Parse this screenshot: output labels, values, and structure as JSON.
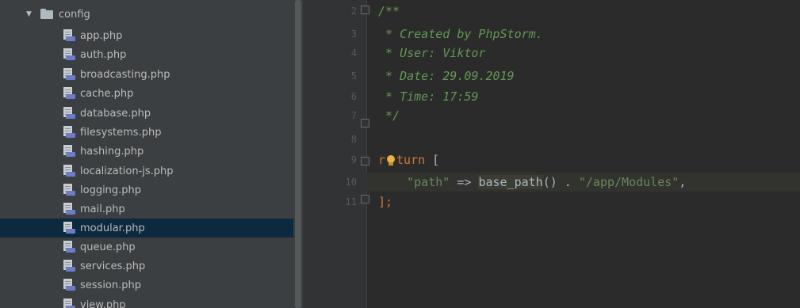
{
  "project_tree": {
    "folder": {
      "name": "config",
      "expanded": true,
      "arrow_icon": "triangle-down-icon",
      "icon": "folder-icon"
    },
    "files": [
      {
        "name": "app.php"
      },
      {
        "name": "auth.php"
      },
      {
        "name": "broadcasting.php"
      },
      {
        "name": "cache.php"
      },
      {
        "name": "database.php"
      },
      {
        "name": "filesystems.php"
      },
      {
        "name": "hashing.php"
      },
      {
        "name": "localization-js.php"
      },
      {
        "name": "logging.php"
      },
      {
        "name": "mail.php"
      },
      {
        "name": "modular.php",
        "selected": true
      },
      {
        "name": "queue.php"
      },
      {
        "name": "services.php"
      },
      {
        "name": "session.php"
      },
      {
        "name": "view.php"
      }
    ],
    "file_icon": "php-file-icon",
    "selection_color": "#0d293e"
  },
  "editor": {
    "line_numbers": [
      "2",
      "3",
      "4",
      "5",
      "6",
      "7",
      "8",
      "9",
      "10",
      "11"
    ],
    "lines": {
      "l2": "/**",
      "l3": " * Created by PhpStorm.",
      "l4": " * User: Viktor",
      "l5": " * Date: 29.09.2019",
      "l6": " * Time: 17:59",
      "l7": " */",
      "l9_kw_start": "r",
      "l9_kw_end": "turn",
      "l9_rest": " [",
      "l10_indent": "    ",
      "l10_str1": "\"path\"",
      "l10_op": " => ",
      "l10_fn": "base_path",
      "l10_call": "() . ",
      "l10_str2": "\"/app/Modules\"",
      "l10_comma": ",",
      "l11": "];"
    },
    "intention_icon": "lightbulb-icon",
    "colors": {
      "background": "#2b2b2b",
      "comment": "#629755",
      "keyword": "#cc7832",
      "string": "#6a8759"
    }
  }
}
